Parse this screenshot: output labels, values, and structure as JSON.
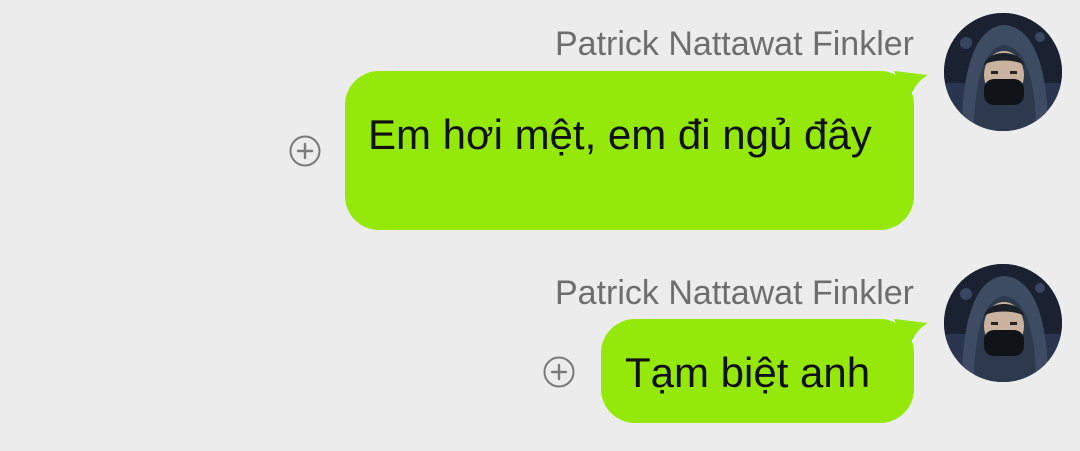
{
  "colors": {
    "background": "#ececec",
    "bubble": "#94e80a",
    "sender_name": "#6e6e6e",
    "icon": "#7a7a7a"
  },
  "messages": [
    {
      "sender": "Patrick Nattawat Finkler",
      "text": "Em hơi mệt, em đi ngủ đây",
      "avatar_icon": "hooded-person-avatar",
      "action_icon": "add-reaction-icon"
    },
    {
      "sender": "Patrick Nattawat Finkler",
      "text": "Tạm biệt anh",
      "avatar_icon": "hooded-person-avatar",
      "action_icon": "add-reaction-icon"
    }
  ]
}
